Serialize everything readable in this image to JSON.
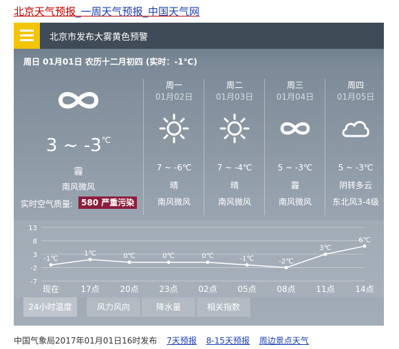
{
  "page": {
    "title_parts": [
      "北京天气预报",
      "_一周天气预报",
      "_中国天气网"
    ]
  },
  "header": {
    "alert_text": "北京市发布大雾黄色预警"
  },
  "today": {
    "date_line": "周日 01月01日 农历十二月初四 (实时：-1℃)",
    "icon": "haze-icon",
    "temp_text": "3 ~ -3",
    "temp_unit": "℃",
    "weather": "霾",
    "wind": "南风微风",
    "aqi_label": "实时空气质量:",
    "aqi_value": "580 严重污染"
  },
  "forecast": [
    {
      "name": "周一",
      "date": "01月02日",
      "icon": "sun-icon",
      "temp": "7 ~ -6℃",
      "weather": "晴",
      "wind": "南风微风"
    },
    {
      "name": "周二",
      "date": "01月03日",
      "icon": "sun-icon",
      "temp": "7 ~ -4℃",
      "weather": "晴",
      "wind": "南风微风"
    },
    {
      "name": "周三",
      "date": "01月04日",
      "icon": "haze-icon",
      "temp": "5 ~ -3℃",
      "weather": "霾",
      "wind": "南风微风"
    },
    {
      "name": "周四",
      "date": "01月05日",
      "icon": "cloud-icon",
      "temp": "5 ~ -3℃",
      "weather": "阴转多云",
      "wind": "东北风3-4级"
    }
  ],
  "chart_data": {
    "type": "line",
    "categories": [
      "现在",
      "17点",
      "20点",
      "23点",
      "02点",
      "05点",
      "08点",
      "11点",
      "14点"
    ],
    "values": [
      -1,
      1,
      0,
      0,
      0,
      -1,
      -2,
      3,
      6
    ],
    "point_labels": [
      "-1℃",
      "1℃",
      "0℃",
      "0℃",
      "0℃",
      "-1℃",
      "-2℃",
      "3℃",
      "6℃"
    ],
    "y_ticks": [
      "13",
      "8",
      "3",
      "-2",
      "-7"
    ],
    "ylim": [
      -7,
      13
    ],
    "grid": true,
    "line_color": "#ffffff"
  },
  "tabs": [
    "24小时温度",
    "风力风向",
    "降水量",
    "相关指数"
  ],
  "footer": {
    "publish_text": "中国气象局2017年01月01日16时发布",
    "links": [
      "7天预报",
      "8-15天预报",
      "周边景点天气"
    ]
  }
}
